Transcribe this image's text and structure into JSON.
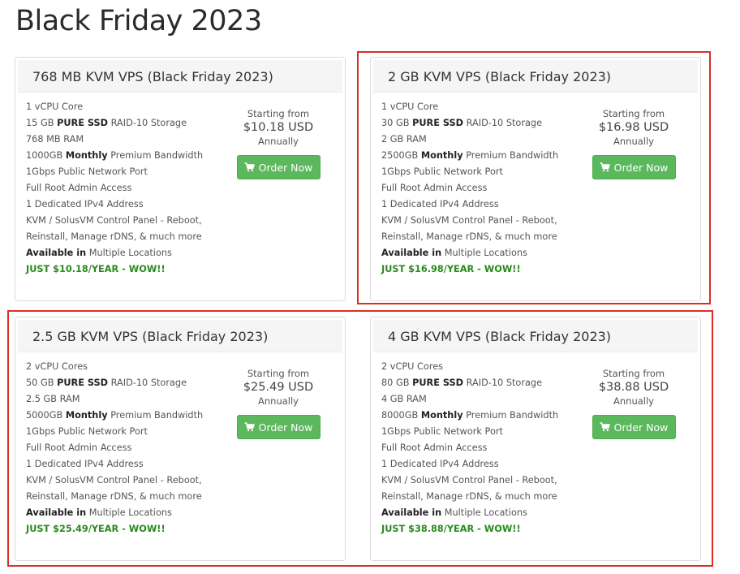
{
  "page": {
    "title": "Black Friday 2023"
  },
  "common": {
    "starting_label": "Starting from",
    "period": "Annually",
    "order_label": "Order Now",
    "cart_icon": "shopping-cart-icon",
    "accent": "#5cb85c",
    "promo_color": "#2a8a1e",
    "highlight_color": "#d93025"
  },
  "plans": [
    {
      "title": "768 MB KVM VPS (Black Friday 2023)",
      "price": "$10.18 USD",
      "features": {
        "cpu": "1 vCPU Core",
        "storage_size": "15 GB",
        "storage_type": "PURE SSD",
        "storage_rest": "RAID-10 Storage",
        "ram": "768 MB RAM",
        "bw_size": "1000GB",
        "bw_period": "Monthly",
        "bw_rest": "Premium Bandwidth",
        "port": "1Gbps Public Network Port",
        "root": "Full Root Admin Access",
        "ip": "1 Dedicated IPv4 Address",
        "panel1": "KVM / SolusVM Control Panel - Reboot,",
        "panel2": "Reinstall, Manage rDNS, & much more",
        "avail_bold": "Available in",
        "avail_rest": "Multiple Locations",
        "promo": "JUST $10.18/YEAR - WOW!!"
      }
    },
    {
      "title": "2 GB KVM VPS (Black Friday 2023)",
      "price": "$16.98 USD",
      "features": {
        "cpu": "1 vCPU Core",
        "storage_size": "30 GB",
        "storage_type": "PURE SSD",
        "storage_rest": "RAID-10 Storage",
        "ram": "2 GB RAM",
        "bw_size": "2500GB",
        "bw_period": "Monthly",
        "bw_rest": "Premium Bandwidth",
        "port": "1Gbps Public Network Port",
        "root": "Full Root Admin Access",
        "ip": "1 Dedicated IPv4 Address",
        "panel1": "KVM / SolusVM Control Panel - Reboot,",
        "panel2": "Reinstall, Manage rDNS, & much more",
        "avail_bold": "Available in",
        "avail_rest": "Multiple Locations",
        "promo": "JUST $16.98/YEAR - WOW!!"
      }
    },
    {
      "title": "2.5 GB KVM VPS (Black Friday 2023)",
      "price": "$25.49 USD",
      "features": {
        "cpu": "2 vCPU Cores",
        "storage_size": "50 GB",
        "storage_type": "PURE SSD",
        "storage_rest": "RAID-10 Storage",
        "ram": "2.5 GB RAM",
        "bw_size": "5000GB",
        "bw_period": "Monthly",
        "bw_rest": "Premium Bandwidth",
        "port": "1Gbps Public Network Port",
        "root": "Full Root Admin Access",
        "ip": "1 Dedicated IPv4 Address",
        "panel1": "KVM / SolusVM Control Panel - Reboot,",
        "panel2": "Reinstall, Manage rDNS, & much more",
        "avail_bold": "Available in",
        "avail_rest": "Multiple Locations",
        "promo": "JUST $25.49/YEAR - WOW!!"
      }
    },
    {
      "title": "4 GB KVM VPS (Black Friday 2023)",
      "price": "$38.88 USD",
      "features": {
        "cpu": "2 vCPU Cores",
        "storage_size": "80 GB",
        "storage_type": "PURE SSD",
        "storage_rest": "RAID-10 Storage",
        "ram": "4 GB RAM",
        "bw_size": "8000GB",
        "bw_period": "Monthly",
        "bw_rest": "Premium Bandwidth",
        "port": "1Gbps Public Network Port",
        "root": "Full Root Admin Access",
        "ip": "1 Dedicated IPv4 Address",
        "panel1": "KVM / SolusVM Control Panel - Reboot,",
        "panel2": "Reinstall, Manage rDNS, & much more",
        "avail_bold": "Available in",
        "avail_rest": "Multiple Locations",
        "promo": "JUST $38.88/YEAR - WOW!!"
      }
    }
  ]
}
